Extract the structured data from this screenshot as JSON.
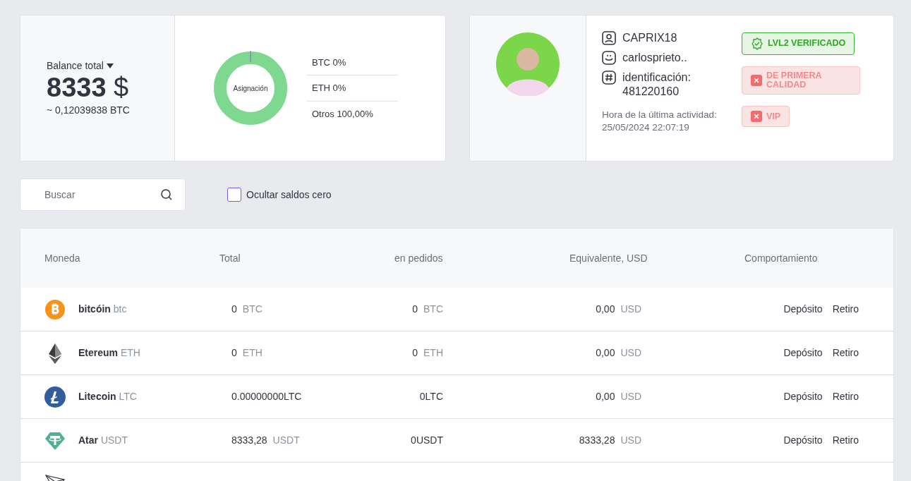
{
  "balance": {
    "label": "Balance total",
    "amount": "8333",
    "currency": "$",
    "btc_equivalent": "~ 0,12039838 BTC"
  },
  "allocation": {
    "center_label": "Asignación",
    "legend": [
      "BTC 0%",
      "ETH 0%",
      "Otros 100,00%"
    ]
  },
  "profile": {
    "fields": [
      "CAPRIX18",
      "carlosprieto..",
      "identificación: 481220160"
    ],
    "last_activity": "Hora de la última actividad: 25/05/2024 22:07:19",
    "badges": [
      {
        "text": "LVL2 VERIFICADO",
        "verified": true
      },
      {
        "text": "DE PRIMERA CALIDAD",
        "verified": false
      },
      {
        "text": "VIP",
        "verified": false
      }
    ]
  },
  "search": {
    "placeholder": "Buscar"
  },
  "hide_zero": {
    "label": "Ocultar saldos cero",
    "checked": false
  },
  "table": {
    "columns": [
      "Moneda",
      "Total",
      "en pedidos",
      "Equivalente, USD",
      "Comportamiento"
    ],
    "rows": [
      {
        "kind": "coin",
        "name": "bitcóin",
        "ticker": "btc",
        "total": "0",
        "total_unit": "BTC",
        "orders": "0",
        "orders_unit": "BTC",
        "usd": "0,00",
        "usd_unit": "USD",
        "actions": [
          "Depósito",
          "Retiro"
        ]
      },
      {
        "kind": "coin",
        "name": "Etereum",
        "ticker": "ETH",
        "total": "0",
        "total_unit": "ETH",
        "orders": "0",
        "orders_unit": "ETH",
        "usd": "0,00",
        "usd_unit": "USD",
        "actions": [
          "Depósito",
          "Retiro"
        ]
      },
      {
        "kind": "coin",
        "name": "Litecoin",
        "ticker": "LTC",
        "total": "0.00000000LTC",
        "orders": "0LTC",
        "usd": "0,00",
        "usd_unit": "USD",
        "actions": [
          "Depósito",
          "Retiro"
        ]
      },
      {
        "kind": "coin",
        "name": "Atar",
        "ticker": "USDT",
        "total": "8333,28",
        "total_unit": "USDT",
        "orders": "0USDT",
        "usd": "8333,28",
        "usd_unit": "USD",
        "actions": [
          "Depósito",
          "Retiro"
        ]
      },
      {
        "kind": "cut"
      }
    ]
  }
}
